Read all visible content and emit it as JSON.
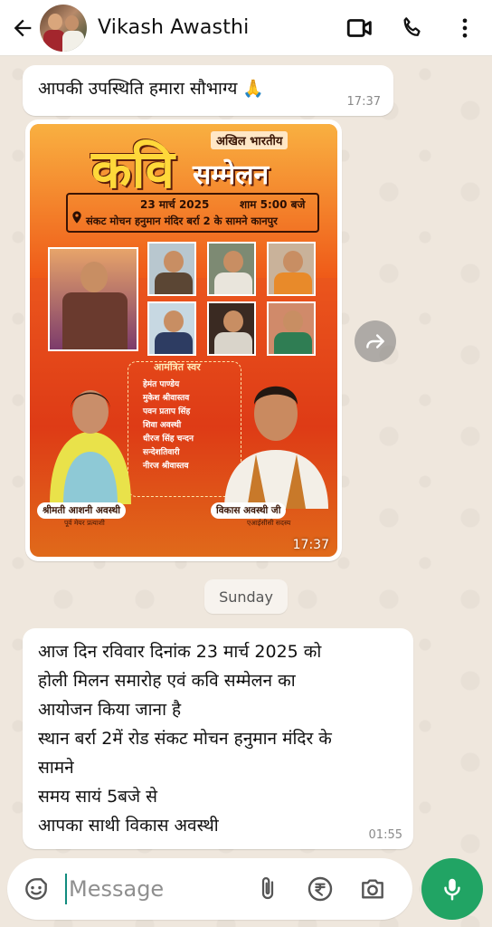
{
  "header": {
    "contact_name": "Vikash Awasthi"
  },
  "messages": [
    {
      "text": "आपकी उपस्थिति हमारा सौभाग्य 🙏",
      "time": "17:37"
    },
    {
      "type": "image",
      "time": "17:37",
      "poster": {
        "akhil": "अखिल भारतीय",
        "kavi": "कवि",
        "sammelan": "सम्मेलन",
        "date": "23 मार्च 2025",
        "time": "शाम 5:00 बजे",
        "venue": "संकट मोचन हनुमान मंदिर बर्रा 2 के सामने कानपुर",
        "invited_title": "आमंत्रित स्वर",
        "invited": [
          "हेमंत पाण्डेय",
          "मुकेश श्रीवास्तव",
          "पवन प्रताप सिंह",
          "शिवा अवस्थी",
          "धीरज सिंह चन्दन",
          "सन्देशतिवारी",
          "नीरज श्रीवास्तव"
        ],
        "left_name": "श्रीमती आशनी अवस्थी",
        "left_sub": "पूर्व मेयर प्रत्याशी",
        "right_name": "विकास अवस्थी जी",
        "right_sub": "एआईसीसी सदस्य"
      }
    },
    {
      "lines": [
        "आज दिन रविवार दिनांक 23 मार्च 2025 को",
        "होली मिलन समारोह एवं कवि सम्मेलन का",
        "आयोजन किया जाना है",
        "स्थान बर्रा 2में रोड संकट मोचन हनुमान मंदिर के",
        "सामने",
        "समय सायं 5बजे से",
        "आपका साथी विकास अवस्थी"
      ],
      "time": "01:55"
    }
  ],
  "day_separator": "Sunday",
  "composer": {
    "placeholder": "Message"
  },
  "icons": {
    "back": "arrow-left-icon",
    "video": "video-call-icon",
    "phone": "phone-icon",
    "menu": "more-vertical-icon",
    "forward": "forward-icon",
    "emoji": "emoji-icon",
    "attach": "paperclip-icon",
    "payment": "rupee-icon",
    "camera": "camera-icon",
    "mic": "microphone-icon"
  },
  "colors": {
    "accent": "#21a464",
    "wallpaper": "#efe7dd"
  }
}
